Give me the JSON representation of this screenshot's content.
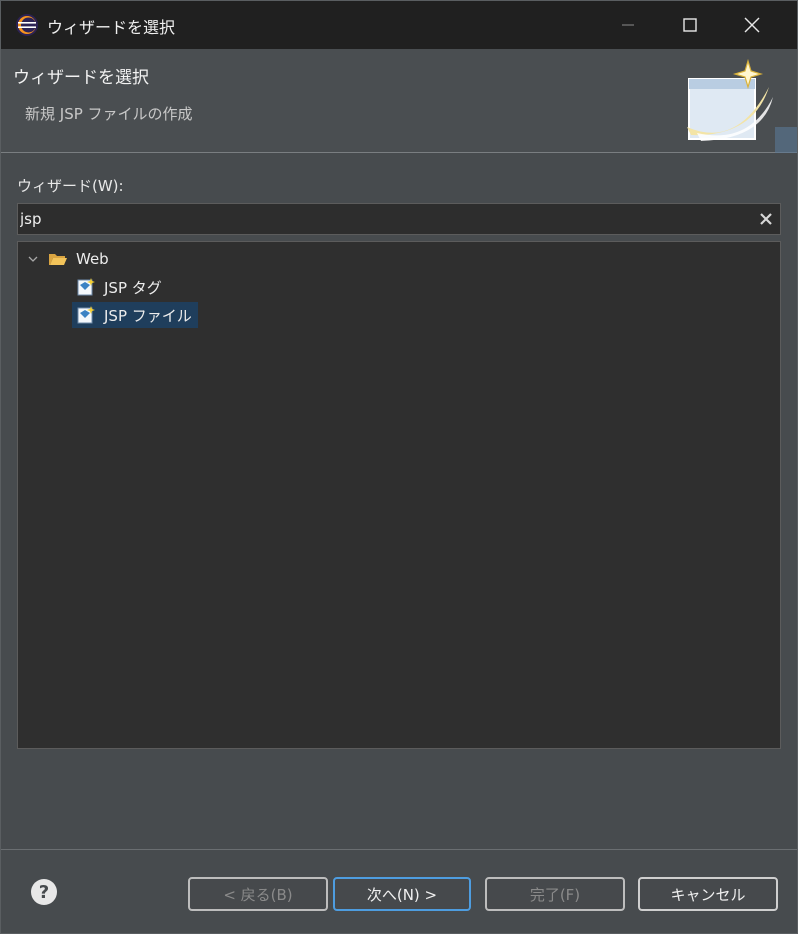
{
  "window": {
    "title": "ウィザードを選択",
    "controls": {
      "minimize": "minimize-icon",
      "maximize": "maximize-icon",
      "close": "close-icon"
    }
  },
  "banner": {
    "title": "ウィザードを選択",
    "subtitle": "新規 JSP ファイルの作成"
  },
  "wizards": {
    "label": "ウィザード(W):",
    "filter_value": "jsp",
    "tree": {
      "folder": "Web",
      "items": [
        {
          "label": "JSP タグ",
          "selected": false
        },
        {
          "label": "JSP ファイル",
          "selected": true
        }
      ]
    }
  },
  "footer": {
    "back": "< 戻る(B)",
    "next": "次へ(N) >",
    "finish": "完了(F)",
    "cancel": "キャンセル"
  },
  "colors": {
    "selection": "#1f3e5c",
    "default_button_border": "#4e9de0",
    "background": "#474b4e"
  }
}
